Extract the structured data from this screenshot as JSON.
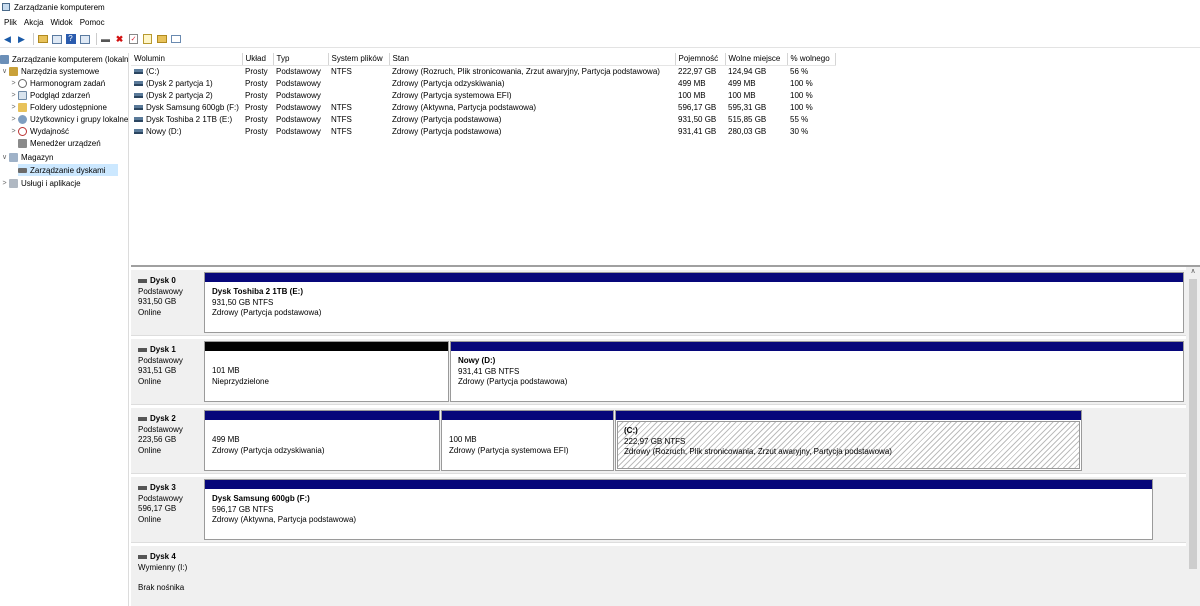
{
  "window": {
    "title": "Zarządzanie komputerem"
  },
  "menu": [
    "Plik",
    "Akcja",
    "Widok",
    "Pomoc"
  ],
  "toolbar": {
    "icons": [
      "back-arrow-icon",
      "forward-arrow-icon",
      "up-folder-icon",
      "properties-icon",
      "help-icon",
      "show-pane-icon",
      "connect-icon",
      "delete-icon",
      "check-icon",
      "new-icon",
      "folder-icon",
      "view-icon"
    ]
  },
  "tree": {
    "root": "Zarządzanie komputerem (lokalne)",
    "system_tools": "Narzędzia systemowe",
    "scheduler": "Harmonogram zadań",
    "event_viewer": "Podgląd zdarzeń",
    "shared_folders": "Foldery udostępnione",
    "users_groups": "Użytkownicy i grupy lokalne",
    "performance": "Wydajność",
    "device_manager": "Menedżer urządzeń",
    "storage": "Magazyn",
    "disk_management": "Zarządzanie dyskami",
    "services_apps": "Usługi i aplikacje"
  },
  "volumes": {
    "headers": [
      "Wolumin",
      "Układ",
      "Typ",
      "System plików",
      "Stan",
      "Pojemność",
      "Wolne miejsce",
      "% wolnego"
    ],
    "rows": [
      [
        "(C:)",
        "Prosty",
        "Podstawowy",
        "NTFS",
        "Zdrowy (Rozruch, Plik stronicowania, Zrzut awaryjny, Partycja podstawowa)",
        "222,97 GB",
        "124,94 GB",
        "56 %"
      ],
      [
        "(Dysk 2 partycja 1)",
        "Prosty",
        "Podstawowy",
        "",
        "Zdrowy (Partycja odzyskiwania)",
        "499 MB",
        "499 MB",
        "100 %"
      ],
      [
        "(Dysk 2 partycja 2)",
        "Prosty",
        "Podstawowy",
        "",
        "Zdrowy (Partycja systemowa EFI)",
        "100 MB",
        "100 MB",
        "100 %"
      ],
      [
        "Dysk Samsung 600gb (F:)",
        "Prosty",
        "Podstawowy",
        "NTFS",
        "Zdrowy (Aktywna, Partycja podstawowa)",
        "596,17 GB",
        "595,31 GB",
        "100 %"
      ],
      [
        "Dysk Toshiba 2 1TB (E:)",
        "Prosty",
        "Podstawowy",
        "NTFS",
        "Zdrowy (Partycja podstawowa)",
        "931,50 GB",
        "515,85 GB",
        "55 %"
      ],
      [
        "Nowy (D:)",
        "Prosty",
        "Podstawowy",
        "NTFS",
        "Zdrowy (Partycja podstawowa)",
        "931,41 GB",
        "280,03 GB",
        "30 %"
      ]
    ]
  },
  "disks": [
    {
      "name": "Dysk 0",
      "type": "Podstawowy",
      "size": "931,50 GB",
      "status": "Online",
      "parts": [
        {
          "title": "Dysk Toshiba 2 1TB  (E:)",
          "size": "931,50 GB NTFS",
          "status": "Zdrowy (Partycja podstawowa)"
        }
      ]
    },
    {
      "name": "Dysk 1",
      "type": "Podstawowy",
      "size": "931,51 GB",
      "status": "Online",
      "parts": [
        {
          "size": "101 MB",
          "status": "Nieprzydzielone"
        },
        {
          "title": "Nowy  (D:)",
          "size": "931,41 GB NTFS",
          "status": "Zdrowy (Partycja podstawowa)"
        }
      ]
    },
    {
      "name": "Dysk 2",
      "type": "Podstawowy",
      "size": "223,56 GB",
      "status": "Online",
      "parts": [
        {
          "size": "499 MB",
          "status": "Zdrowy (Partycja odzyskiwania)"
        },
        {
          "size": "100 MB",
          "status": "Zdrowy (Partycja systemowa EFI)"
        },
        {
          "title": "(C:)",
          "size": "222,97 GB NTFS",
          "status": "Zdrowy (Rozruch, Plik stronicowania, Zrzut awaryjny, Partycja podstawowa)"
        }
      ]
    },
    {
      "name": "Dysk 3",
      "type": "Podstawowy",
      "size": "596,17 GB",
      "status": "Online",
      "parts": [
        {
          "title": "Dysk Samsung 600gb  (F:)",
          "size": "596,17 GB NTFS",
          "status": "Zdrowy (Aktywna, Partycja podstawowa)"
        }
      ]
    },
    {
      "name": "Dysk 4",
      "type": "Wymienny (I:)",
      "status": "Brak nośnika"
    }
  ],
  "colors": {
    "primary_partition": "#06067a",
    "unallocated": "#000000",
    "selection": "#cce8ff"
  }
}
